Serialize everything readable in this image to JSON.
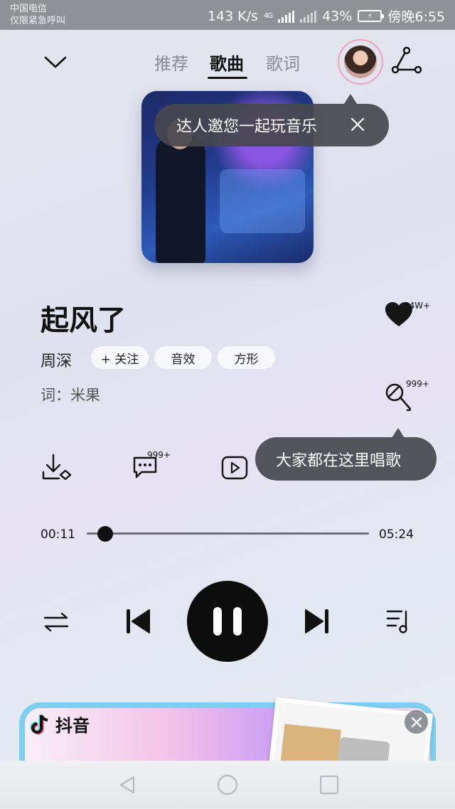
{
  "status_bar": {
    "carrier": "中国电信",
    "emergency": "仅限紧急呼叫",
    "speed": "143 K/s",
    "network": "4G",
    "battery": "43%",
    "time": "傍晚6:55"
  },
  "header": {
    "tabs": [
      {
        "label": "推荐",
        "active": false
      },
      {
        "label": "歌曲",
        "active": true
      },
      {
        "label": "歌词",
        "active": false
      }
    ]
  },
  "invite_tip": {
    "text": "达人邀您一起玩音乐"
  },
  "song": {
    "title": "起风了",
    "artist": "周深",
    "follow_label": "+ 关注",
    "sound_effect_label": "音效",
    "shape_label": "方形",
    "lyricist": "词：米果",
    "like_count": "44W+",
    "karaoke_count": "999+"
  },
  "karaoke_tip": {
    "text": "大家都在这里唱歌"
  },
  "actions": {
    "comment_count": "999+"
  },
  "player": {
    "current_time": "00:11",
    "total_time": "05:24",
    "progress": 0.035
  },
  "ad": {
    "brand": "抖音"
  },
  "icons": [
    "chevron-down-icon",
    "share-icon",
    "close-icon",
    "heart-icon",
    "microphone-icon",
    "download-icon",
    "comment-icon",
    "video-icon",
    "repeat-icon",
    "prev-icon",
    "pause-icon",
    "next-icon",
    "playlist-icon",
    "tiktok-icon",
    "back-icon",
    "home-icon",
    "recents-icon"
  ]
}
